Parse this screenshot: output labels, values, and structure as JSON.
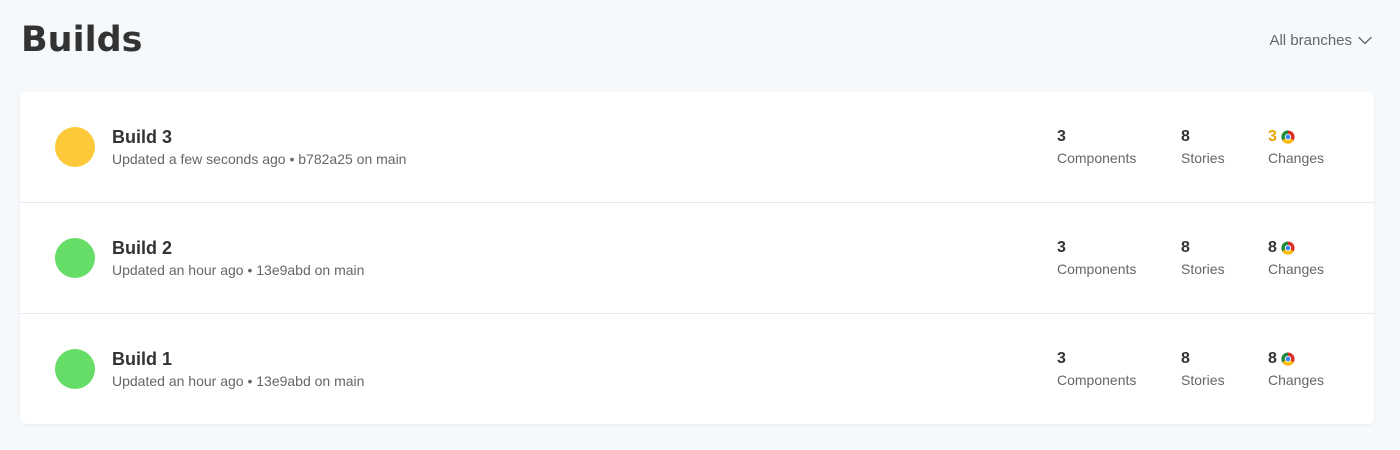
{
  "header": {
    "title": "Builds",
    "branch_filter": "All branches"
  },
  "colors": {
    "pending": "#fdc83a",
    "passed": "#66dd66",
    "pending_changes_text": "#e8a400"
  },
  "builds": [
    {
      "name": "Build 3",
      "status": "pending",
      "updated": "Updated a few seconds ago",
      "separator": "•",
      "commit": "b782a25 on main",
      "components_value": "3",
      "components_label": "Components",
      "stories_value": "8",
      "stories_label": "Stories",
      "changes_value": "3",
      "changes_label": "Changes",
      "changes_icon": "chrome-browser-icon"
    },
    {
      "name": "Build 2",
      "status": "passed",
      "updated": "Updated an hour ago",
      "separator": "•",
      "commit": "13e9abd on main",
      "components_value": "3",
      "components_label": "Components",
      "stories_value": "8",
      "stories_label": "Stories",
      "changes_value": "8",
      "changes_label": "Changes",
      "changes_icon": "chrome-browser-icon"
    },
    {
      "name": "Build 1",
      "status": "passed",
      "updated": "Updated an hour ago",
      "separator": "•",
      "commit": "13e9abd on main",
      "components_value": "3",
      "components_label": "Components",
      "stories_value": "8",
      "stories_label": "Stories",
      "changes_value": "8",
      "changes_label": "Changes",
      "changes_icon": "chrome-browser-icon"
    }
  ]
}
